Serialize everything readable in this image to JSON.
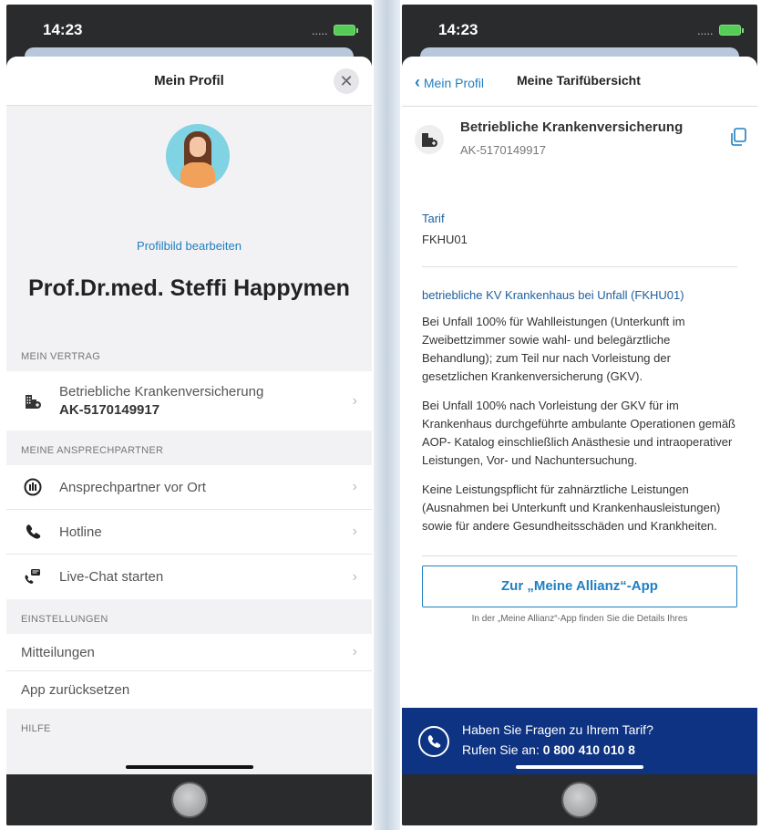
{
  "left": {
    "status_time": "14:23",
    "signal_dots": ".....",
    "header_title": "Mein Profil",
    "close_glyph": "✕",
    "edit_photo_label": "Profilbild bearbeiten",
    "profile_name": "Prof.Dr.med. Steffi Happymen",
    "sections": {
      "contract": {
        "title": "MEIN VERTRAG",
        "name": "Betriebliche Krankenversicherung",
        "number": "AK-5170149917"
      },
      "contacts": {
        "title": "MEINE ANSPRECHPARTNER",
        "items": [
          {
            "label": "Ansprechpartner vor Ort",
            "icon": "people-circle-icon"
          },
          {
            "label": "Hotline",
            "icon": "phone-icon"
          },
          {
            "label": "Live-Chat starten",
            "icon": "chat-icon"
          }
        ]
      },
      "settings": {
        "title": "EINSTELLUNGEN",
        "items": [
          "Mitteilungen",
          "App zurücksetzen"
        ]
      },
      "help": {
        "title": "HILFE"
      }
    }
  },
  "right": {
    "status_time": "14:23",
    "signal_dots": ".....",
    "back_label": "Mein Profil",
    "header_title": "Meine Tarifübersicht",
    "contract_name": "Betriebliche Krankenversicherung",
    "contract_number": "AK-5170149917",
    "tarif_label": "Tarif",
    "tarif_value": "FKHU01",
    "tarif_name": "betriebliche KV Krankenhaus bei Unfall (FKHU01)",
    "paragraphs": [
      "Bei Unfall 100% für Wahlleistungen (Unterkunft im Zweibettzimmer sowie wahl- und belegärztliche Behandlung); zum Teil nur nach Vorleistung der gesetzlichen Krankenversicherung (GKV).",
      "Bei Unfall 100% nach Vorleistung der GKV für im Krankenhaus durchgeführte ambulante Operationen gemäß AOP- Katalog einschließlich Anästhesie und intraoperativer Leistungen, Vor- und Nachuntersuchung.",
      "Keine Leistungspflicht für zahnärztliche Leistungen (Ausnahmen bei Unterkunft und Krankenhausleistungen) sowie für andere Gesundheitsschäden und Krankheiten."
    ],
    "cta_label": "Zur „Meine Allianz“-App",
    "cta_hint": "In der „Meine Allianz“-App finden Sie die Details Ihres",
    "footer_question": "Haben Sie Fragen zu Ihrem Tarif?",
    "footer_call_prefix": "Rufen Sie an:",
    "footer_phone": "0 800 410 010 8"
  },
  "colors": {
    "accent": "#1f7fc1",
    "banner": "#0e3382",
    "sheet_bg": "#f2f2f4"
  }
}
